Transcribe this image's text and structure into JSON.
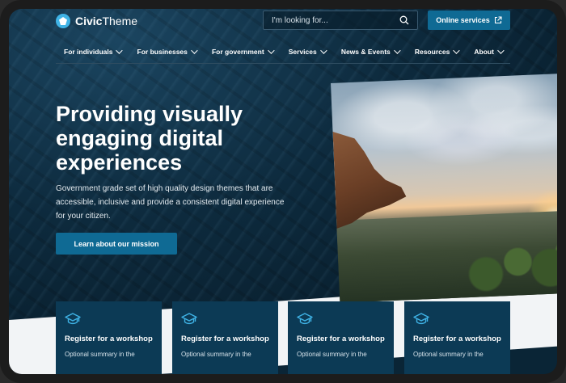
{
  "header": {
    "logo_bold": "Civic",
    "logo_regular": "Theme",
    "logo_icon": "civic-logo-icon",
    "search_placeholder": "I'm looking for...",
    "search_icon": "search-icon",
    "online_services": "Online services",
    "online_services_icon": "external-link-icon"
  },
  "nav": {
    "items": [
      {
        "label": "For individuals"
      },
      {
        "label": "For businesses"
      },
      {
        "label": "For government"
      },
      {
        "label": "Services"
      },
      {
        "label": "News & Events"
      },
      {
        "label": "Resources"
      },
      {
        "label": "About"
      }
    ]
  },
  "hero": {
    "title": "Providing visually engaging digital experiences",
    "description": "Government grade set of high quality design themes that are accessible, inclusive and provide a consistent digital experience for your citizen.",
    "button": "Learn about our mission"
  },
  "cards": [
    {
      "icon": "graduation-cap-icon",
      "title": "Register for a workshop",
      "summary": "Optional summary in the"
    },
    {
      "icon": "graduation-cap-icon",
      "title": "Register for a workshop",
      "summary": "Optional summary in the"
    },
    {
      "icon": "graduation-cap-icon",
      "title": "Register for a workshop",
      "summary": "Optional summary in the"
    },
    {
      "icon": "graduation-cap-icon",
      "title": "Register for a workshop",
      "summary": "Optional summary in the"
    }
  ],
  "colors": {
    "brand_dark": "#0a2536",
    "accent": "#0f6a94",
    "card_bg": "#0c3a55",
    "icon_accent": "#3fb3e6"
  }
}
